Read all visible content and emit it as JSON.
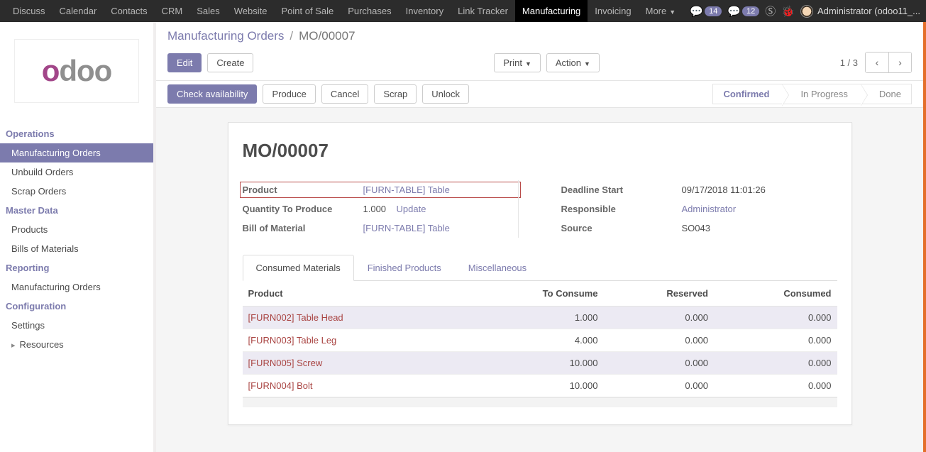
{
  "topnav": {
    "items": [
      "Discuss",
      "Calendar",
      "Contacts",
      "CRM",
      "Sales",
      "Website",
      "Point of Sale",
      "Purchases",
      "Inventory",
      "Link Tracker",
      "Manufacturing",
      "Invoicing",
      "More"
    ],
    "active_index": 10,
    "badges": {
      "messages": "14",
      "chat": "12"
    },
    "user_label": "Administrator (odoo11_..."
  },
  "sidebar": {
    "logo": "odoo",
    "sections": [
      {
        "title": "Operations",
        "items": [
          "Manufacturing Orders",
          "Unbuild Orders",
          "Scrap Orders"
        ],
        "active_index": 0
      },
      {
        "title": "Master Data",
        "items": [
          "Products",
          "Bills of Materials"
        ],
        "active_index": -1
      },
      {
        "title": "Reporting",
        "items": [
          "Manufacturing Orders"
        ],
        "active_index": -1
      },
      {
        "title": "Configuration",
        "items": [
          "Settings",
          "Resources"
        ],
        "active_index": -1,
        "arrow_index": 1
      }
    ]
  },
  "breadcrumb": {
    "parent": "Manufacturing Orders",
    "current": "MO/00007"
  },
  "controls": {
    "edit": "Edit",
    "create": "Create",
    "print": "Print",
    "action": "Action",
    "pager": "1 / 3"
  },
  "actionbar": {
    "buttons": [
      "Check availability",
      "Produce",
      "Cancel",
      "Scrap",
      "Unlock"
    ],
    "primary_index": 0,
    "status_steps": [
      "Confirmed",
      "In Progress",
      "Done"
    ],
    "status_active_index": 0
  },
  "record": {
    "title": "MO/00007",
    "left": {
      "product_label": "Product",
      "product_value": "[FURN-TABLE] Table",
      "qty_label": "Quantity To Produce",
      "qty_value": "1.000",
      "qty_update": "Update",
      "bom_label": "Bill of Material",
      "bom_value": "[FURN-TABLE] Table"
    },
    "right": {
      "deadline_label": "Deadline Start",
      "deadline_value": "09/17/2018 11:01:26",
      "responsible_label": "Responsible",
      "responsible_value": "Administrator",
      "source_label": "Source",
      "source_value": "SO043"
    }
  },
  "tabs": {
    "items": [
      "Consumed Materials",
      "Finished Products",
      "Miscellaneous"
    ],
    "active_index": 0
  },
  "table": {
    "headers": [
      "Product",
      "To Consume",
      "Reserved",
      "Consumed"
    ],
    "rows": [
      {
        "product": "[FURN002] Table Head",
        "to_consume": "1.000",
        "reserved": "0.000",
        "consumed": "0.000"
      },
      {
        "product": "[FURN003] Table Leg",
        "to_consume": "4.000",
        "reserved": "0.000",
        "consumed": "0.000"
      },
      {
        "product": "[FURN005] Screw",
        "to_consume": "10.000",
        "reserved": "0.000",
        "consumed": "0.000"
      },
      {
        "product": "[FURN004] Bolt",
        "to_consume": "10.000",
        "reserved": "0.000",
        "consumed": "0.000"
      }
    ]
  }
}
